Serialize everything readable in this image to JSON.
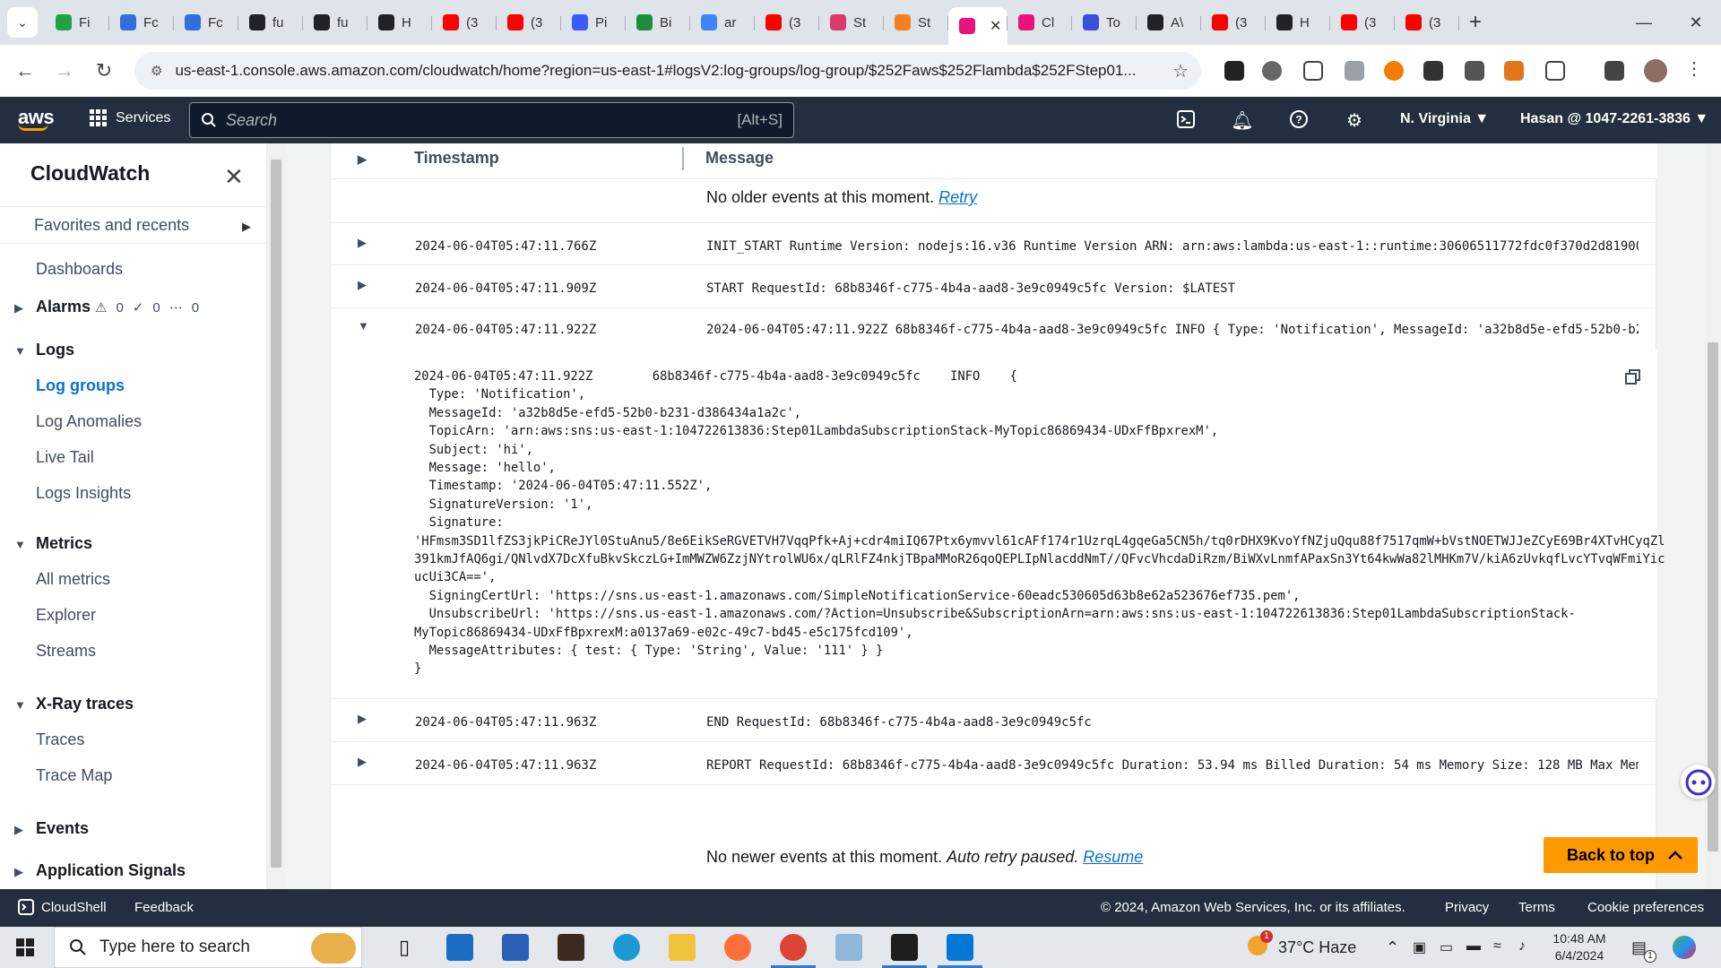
{
  "browser": {
    "tabs": [
      {
        "label": "Fi",
        "color": "#1ea446"
      },
      {
        "label": "Fc",
        "color": "#2f6fe0"
      },
      {
        "label": "Fc",
        "color": "#2f6fe0"
      },
      {
        "label": "fu",
        "color": "#1f2328"
      },
      {
        "label": "fu",
        "color": "#1f2328"
      },
      {
        "label": "H",
        "color": "#1f2328"
      },
      {
        "label": "(3",
        "color": "#ff0000"
      },
      {
        "label": "(3",
        "color": "#ff0000"
      },
      {
        "label": "Pi",
        "color": "#3d5afe"
      },
      {
        "label": "Bi",
        "color": "#1e8e3e"
      },
      {
        "label": "ar",
        "color": "#4285f4"
      },
      {
        "label": "(3",
        "color": "#ff0000"
      },
      {
        "label": "St",
        "color": "#d93a6b"
      },
      {
        "label": "St",
        "color": "#f48024"
      },
      {
        "label": "",
        "color": "#e7157b"
      },
      {
        "label": "Cl",
        "color": "#e7157b"
      },
      {
        "label": "To",
        "color": "#3b4fd8"
      },
      {
        "label": "A\\",
        "color": "#1f2328"
      },
      {
        "label": "(3",
        "color": "#ff0000"
      },
      {
        "label": "H",
        "color": "#1f2328"
      },
      {
        "label": "(3",
        "color": "#ff0000"
      },
      {
        "label": "(3",
        "color": "#ff0000"
      }
    ],
    "url": "us-east-1.console.aws.amazon.com/cloudwatch/home?region=us-east-1#logsV2:log-groups/log-group/$252Faws$252Flambda$252FStep01..."
  },
  "awsnav": {
    "services_label": "Services",
    "search_placeholder": "Search",
    "search_shortcut": "[Alt+S]",
    "region": "N. Virginia ▼",
    "account": "Hasan @ 1047-2261-3836 ▼"
  },
  "sidebar": {
    "title": "CloudWatch",
    "favorites": "Favorites and recents",
    "dashboards": "Dashboards",
    "alarms": "Alarms",
    "alarm_counts": [
      "0",
      "0",
      "0"
    ],
    "logs": "Logs",
    "log_items": [
      "Log groups",
      "Log Anomalies",
      "Live Tail",
      "Logs Insights"
    ],
    "metrics": "Metrics",
    "metric_items": [
      "All metrics",
      "Explorer",
      "Streams"
    ],
    "xray": "X-Ray traces",
    "xray_items": [
      "Traces",
      "Trace Map"
    ],
    "events": "Events",
    "app_signals": "Application Signals"
  },
  "log": {
    "col_timestamp": "Timestamp",
    "col_message": "Message",
    "no_older": "No older events at this moment.",
    "retry": "Retry",
    "rows": [
      {
        "ts": "2024-06-04T05:47:11.766Z",
        "msg": "INIT_START Runtime Version: nodejs:16.v36 Runtime Version ARN: arn:aws:lambda:us-east-1::runtime:30606511772fdc0f370d2d81900..."
      },
      {
        "ts": "2024-06-04T05:47:11.909Z",
        "msg": "START RequestId: 68b8346f-c775-4b4a-aad8-3e9c0949c5fc Version: $LATEST"
      },
      {
        "ts": "2024-06-04T05:47:11.922Z",
        "msg": "2024-06-04T05:47:11.922Z 68b8346f-c775-4b4a-aad8-3e9c0949c5fc INFO { Type: 'Notification', MessageId: 'a32b8d5e-efd5-52b0-b2..."
      },
      {
        "ts": "2024-06-04T05:47:11.963Z",
        "msg": "END RequestId: 68b8346f-c775-4b4a-aad8-3e9c0949c5fc"
      },
      {
        "ts": "2024-06-04T05:47:11.963Z",
        "msg": "REPORT RequestId: 68b8346f-c775-4b4a-aad8-3e9c0949c5fc Duration: 53.94 ms Billed Duration: 54 ms Memory Size: 128 MB Max Mem..."
      }
    ],
    "expanded_lines": [
      "2024-06-04T05:47:11.922Z        68b8346f-c775-4b4a-aad8-3e9c0949c5fc    INFO    {",
      "  Type: 'Notification',",
      "  MessageId: 'a32b8d5e-efd5-52b0-b231-d386434a1a2c',",
      "  TopicArn: 'arn:aws:sns:us-east-1:104722613836:Step01LambdaSubscriptionStack-MyTopic86869434-UDxFfBpxrexM',",
      "  Subject: 'hi',",
      "  Message: 'hello',",
      "  Timestamp: '2024-06-04T05:47:11.552Z',",
      "  SignatureVersion: '1',",
      "  Signature:",
      "'HFmsm3SD1lfZS3jkPiCReJYl0StuAnu5/8e6EikSeRGVETVH7VqqPfk+Aj+cdr4miIQ67Ptx6ymvvl61cAFf174r1UzrqL4gqeGa5CN5h/tq0rDHX9KvoYfNZjuQqu88f7517qmW+bVstNOETWJJeZCyE69Br4XTvHCyqZl",
      "391kmJfAQ6gi/QNlvdX7DcXfuBkvSkczLG+ImMWZW6ZzjNYtrolWU6x/qLRlFZ4nkjTBpaMMoR26qoQEPLIpNlacddNmT//QFvcVhcdaDiRzm/BiWXvLnmfAPaxSn3Yt64kwWa82lMHKm7V/kiA6zUvkqfLvcYTvqWFmiYic",
      "ucUi3CA==',",
      "  SigningCertUrl: 'https://sns.us-east-1.amazonaws.com/SimpleNotificationService-60eadc530605d63b8e62a523676ef735.pem',",
      "  UnsubscribeUrl: 'https://sns.us-east-1.amazonaws.com/?Action=Unsubscribe&SubscriptionArn=arn:aws:sns:us-east-1:104722613836:Step01LambdaSubscriptionStack-",
      "MyTopic86869434-UDxFfBpxrexM:a0137a69-e02c-49c7-bd45-e5c175fcd109',",
      "  MessageAttributes: { test: { Type: 'String', Value: '111' } }",
      "}"
    ],
    "no_newer": "No newer events at this moment.",
    "auto_retry": "Auto retry paused.",
    "resume": "Resume",
    "back_to_top": "Back to top"
  },
  "footer": {
    "cloudshell": "CloudShell",
    "feedback": "Feedback",
    "copyright": "© 2024, Amazon Web Services, Inc. or its affiliates.",
    "privacy": "Privacy",
    "terms": "Terms",
    "cookies": "Cookie preferences"
  },
  "taskbar": {
    "search_placeholder": "Type here to search",
    "weather": "37°C  Haze",
    "time": "10:48 AM",
    "date": "6/4/2024",
    "notif_count": "1",
    "weather_badge": "1"
  }
}
